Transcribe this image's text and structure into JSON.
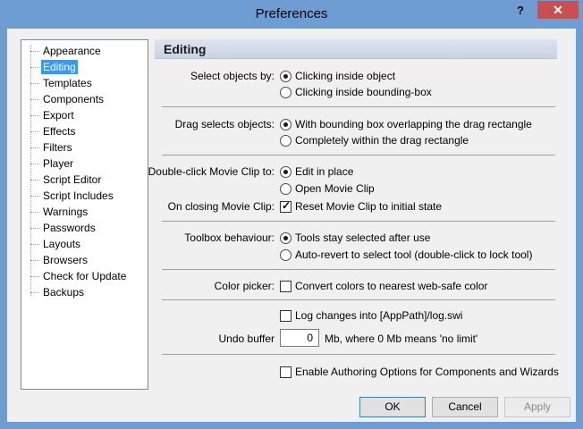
{
  "window": {
    "title": "Preferences",
    "help_glyph": "?",
    "close_glyph": "✕"
  },
  "tree": {
    "items": [
      {
        "label": "Appearance",
        "selected": false
      },
      {
        "label": "Editing",
        "selected": true
      },
      {
        "label": "Templates",
        "selected": false
      },
      {
        "label": "Components",
        "selected": false
      },
      {
        "label": "Export",
        "selected": false
      },
      {
        "label": "Effects",
        "selected": false
      },
      {
        "label": "Filters",
        "selected": false
      },
      {
        "label": "Player",
        "selected": false
      },
      {
        "label": "Script Editor",
        "selected": false
      },
      {
        "label": "Script Includes",
        "selected": false
      },
      {
        "label": "Warnings",
        "selected": false
      },
      {
        "label": "Passwords",
        "selected": false
      },
      {
        "label": "Layouts",
        "selected": false
      },
      {
        "label": "Browsers",
        "selected": false
      },
      {
        "label": "Check for Update",
        "selected": false
      },
      {
        "label": "Backups",
        "selected": false
      }
    ]
  },
  "panel": {
    "title": "Editing",
    "select_objects": {
      "label": "Select objects by:",
      "options": [
        {
          "label": "Clicking inside object",
          "checked": true
        },
        {
          "label": "Clicking inside bounding-box",
          "checked": false
        }
      ]
    },
    "drag_selects": {
      "label": "Drag selects objects:",
      "options": [
        {
          "label": "With bounding box overlapping the drag rectangle",
          "checked": true
        },
        {
          "label": "Completely within the drag rectangle",
          "checked": false
        }
      ]
    },
    "double_click": {
      "label": "Double-click Movie Clip to:",
      "options": [
        {
          "label": "Edit in place",
          "checked": true
        },
        {
          "label": "Open Movie Clip",
          "checked": false
        }
      ]
    },
    "on_closing": {
      "label": "On closing Movie Clip:",
      "checkbox": {
        "label": "Reset Movie Clip to initial state",
        "checked": true
      }
    },
    "toolbox": {
      "label": "Toolbox behaviour:",
      "options": [
        {
          "label": "Tools stay selected after use",
          "checked": true
        },
        {
          "label": "Auto-revert to select tool (double-click to lock tool)",
          "checked": false
        }
      ]
    },
    "color_picker": {
      "label": "Color picker:",
      "checkbox": {
        "label": "Convert colors to nearest web-safe color",
        "checked": false
      }
    },
    "log_changes": {
      "label": "Log changes into [AppPath]/log.swi",
      "checked": false
    },
    "undo_buffer": {
      "label": "Undo buffer",
      "value": "0",
      "suffix": "Mb, where 0 Mb means 'no limit'"
    },
    "authoring": {
      "label": "Enable Authoring Options for Components and Wizards",
      "checked": false
    }
  },
  "buttons": {
    "ok": "OK",
    "cancel": "Cancel",
    "apply": "Apply"
  }
}
